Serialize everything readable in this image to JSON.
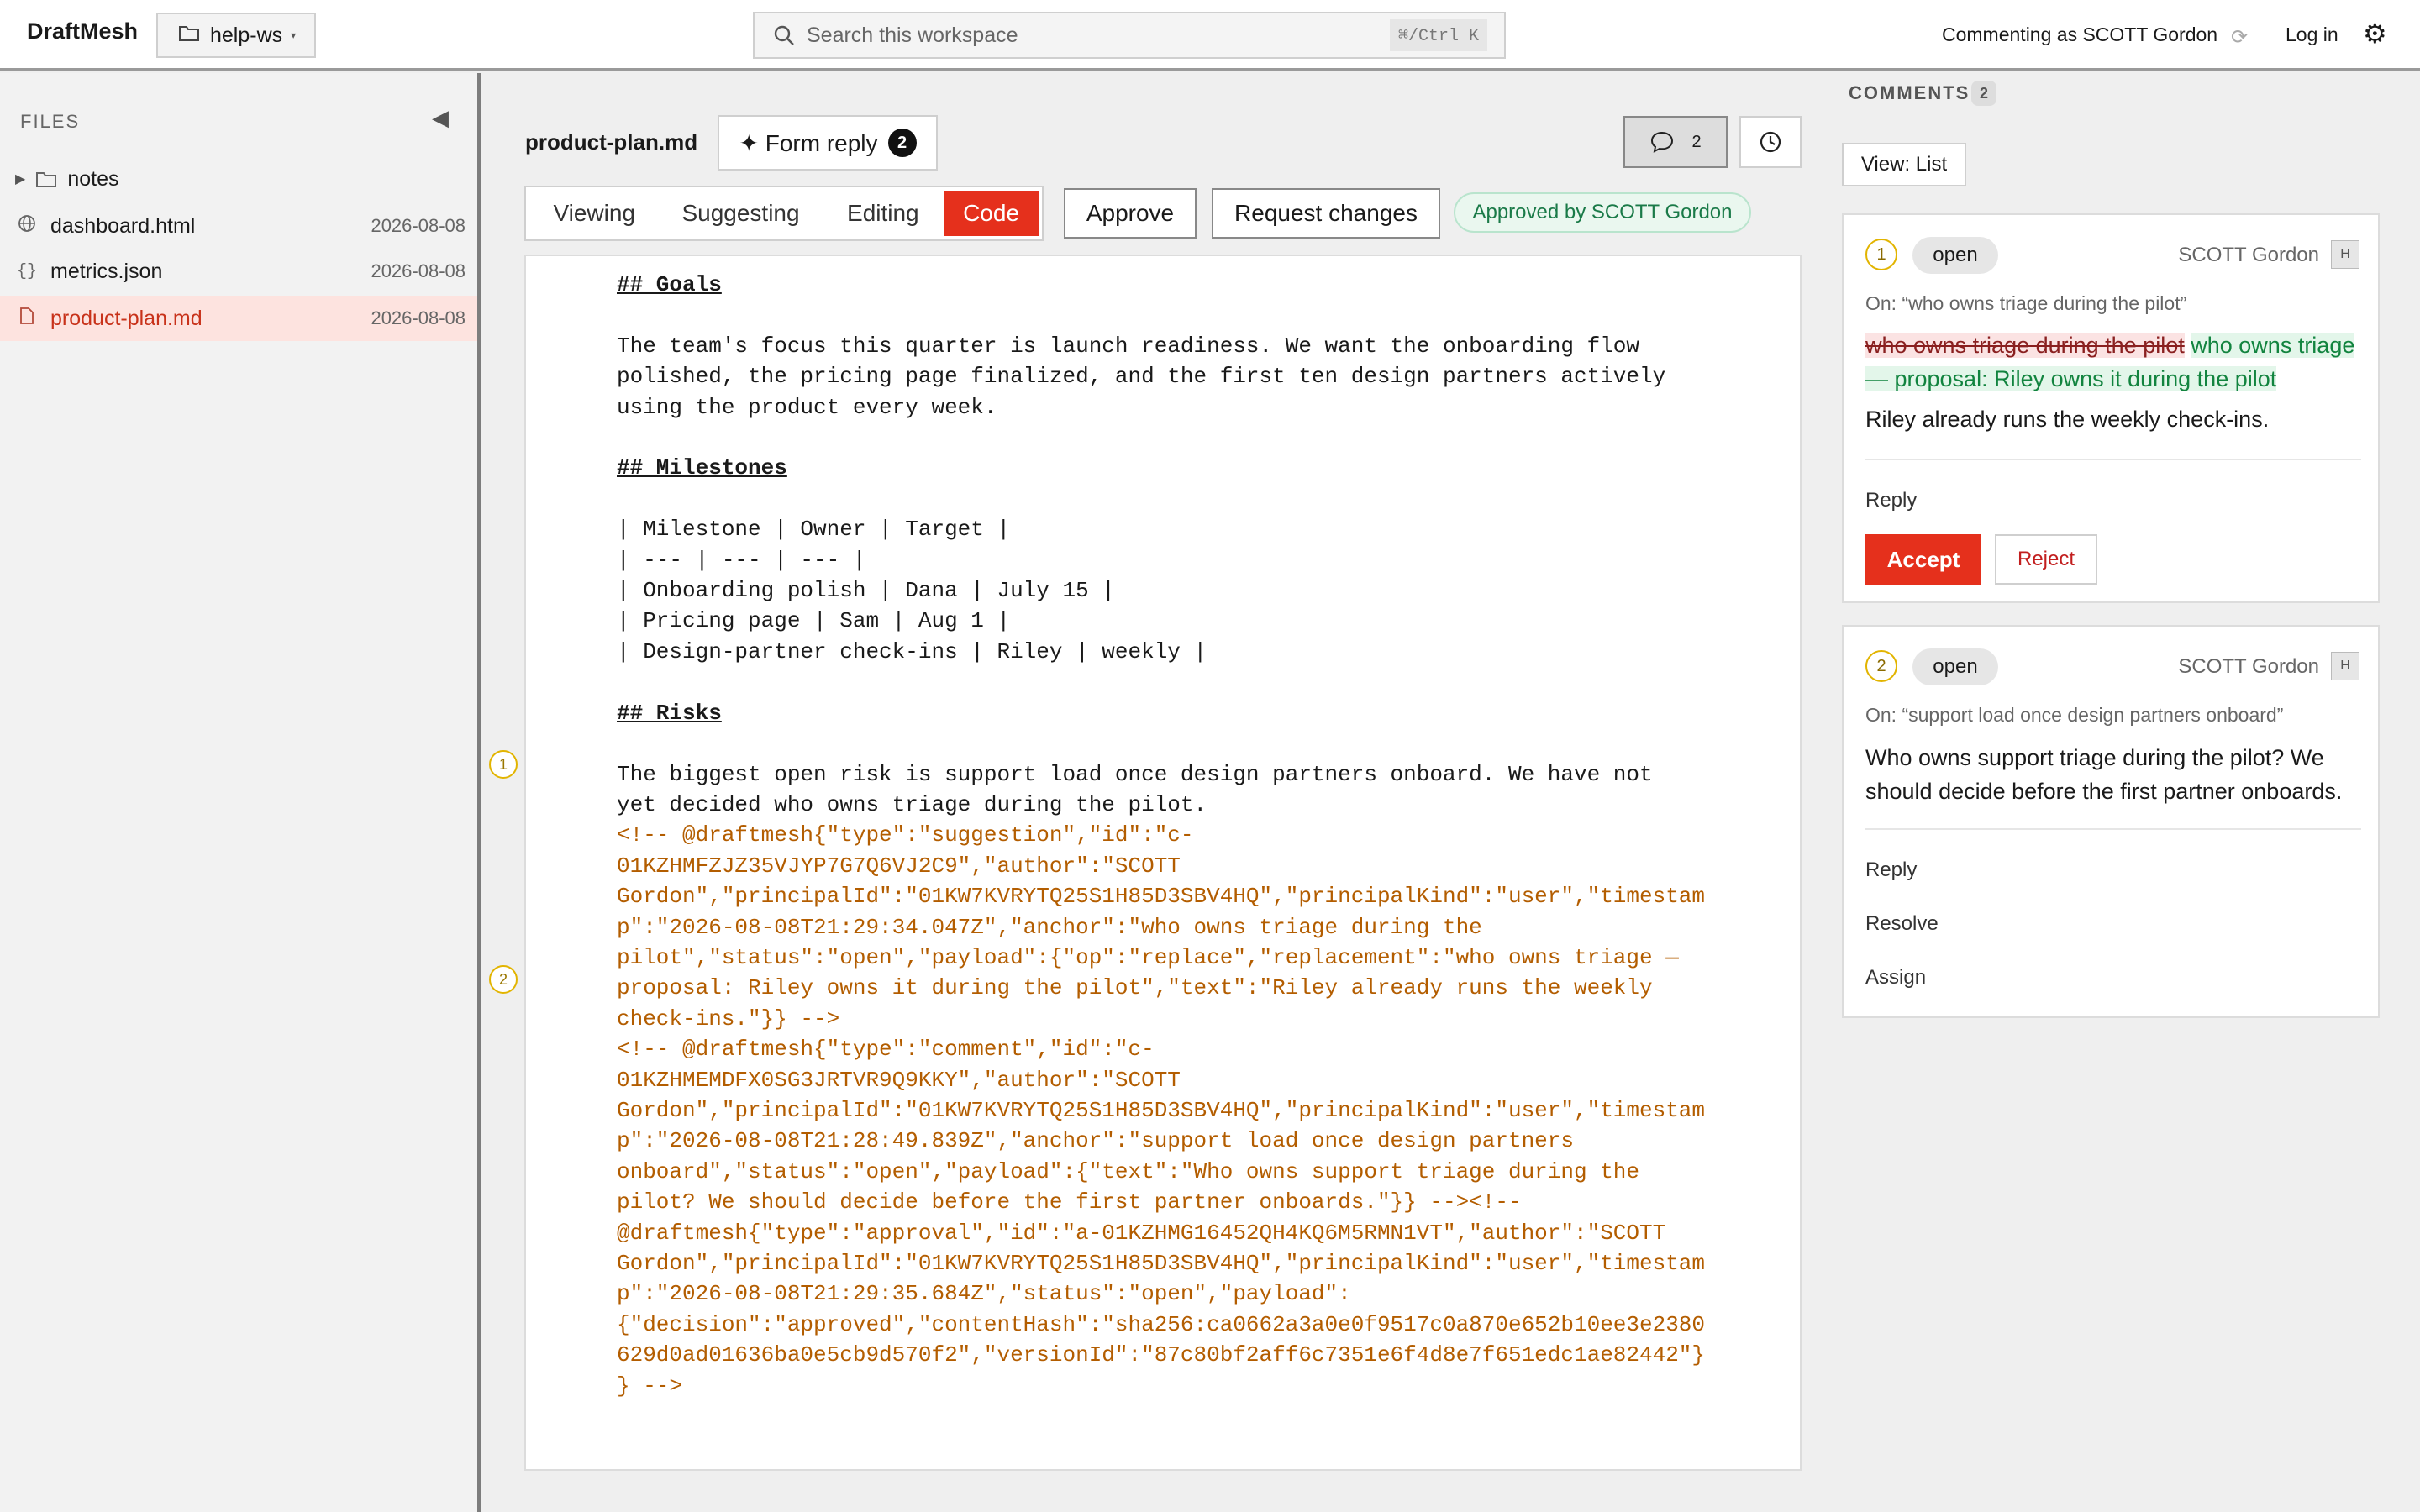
{
  "app": {
    "name": "DraftMesh"
  },
  "workspace": {
    "name": "help-ws",
    "caret": "▾"
  },
  "search": {
    "placeholder": "Search this workspace",
    "shortcut": "⌘/Ctrl K"
  },
  "topbar": {
    "commenting_as": "Commenting as SCOTT Gordon",
    "login": "Log in"
  },
  "sidebar": {
    "title": "FILES",
    "items": [
      {
        "name": "notes",
        "type": "folder",
        "date": ""
      },
      {
        "name": "dashboard.html",
        "type": "html",
        "date": "2026-08-08"
      },
      {
        "name": "metrics.json",
        "type": "json",
        "date": "2026-08-08"
      },
      {
        "name": "product-plan.md",
        "type": "md",
        "date": "2026-08-08",
        "selected": true
      }
    ]
  },
  "editor": {
    "doc_name": "product-plan.md",
    "form_reply": {
      "label": "✦ Form reply",
      "count": "2"
    },
    "comments_count": "2",
    "modes": [
      "Viewing",
      "Suggesting",
      "Editing",
      "Code"
    ],
    "active_mode": "Code",
    "approve": "Approve",
    "request_changes": "Request changes",
    "approved_badge": "Approved by SCOTT Gordon",
    "gutter_marks": [
      "1",
      "2"
    ],
    "lines": [
      {
        "text": "## Goals",
        "style": "h"
      },
      {
        "text": "",
        "style": ""
      },
      {
        "text": "The team's focus this quarter is launch readiness. We want the onboarding flow",
        "style": ""
      },
      {
        "text": "polished, the pricing page finalized, and the first ten design partners actively",
        "style": ""
      },
      {
        "text": "using the product every week.",
        "style": ""
      },
      {
        "text": "",
        "style": ""
      },
      {
        "text": "## Milestones",
        "style": "h"
      },
      {
        "text": "",
        "style": ""
      },
      {
        "text": "| Milestone | Owner | Target |",
        "style": ""
      },
      {
        "text": "| --- | --- | --- |",
        "style": ""
      },
      {
        "text": "| Onboarding polish | Dana | July 15 |",
        "style": ""
      },
      {
        "text": "| Pricing page | Sam | Aug 1 |",
        "style": ""
      },
      {
        "text": "| Design-partner check-ins | Riley | weekly |",
        "style": ""
      },
      {
        "text": "",
        "style": ""
      },
      {
        "text": "## Risks",
        "style": "h"
      },
      {
        "text": "",
        "style": ""
      },
      {
        "text": "The biggest open risk is support load once design partners onboard. We have not",
        "style": ""
      },
      {
        "text": "yet decided who owns triage during the pilot.",
        "style": ""
      },
      {
        "text": "<!-- @draftmesh{\"type\":\"suggestion\",\"id\":\"c-",
        "style": "meta"
      },
      {
        "text": "01KZHMFZJZ35VJYP7G7Q6VJ2C9\",\"author\":\"SCOTT",
        "style": "meta"
      },
      {
        "text": "Gordon\",\"principalId\":\"01KW7KVRYTQ25S1H85D3SBV4HQ\",\"principalKind\":\"user\",\"timestam",
        "style": "meta"
      },
      {
        "text": "p\":\"2026-08-08T21:29:34.047Z\",\"anchor\":\"who owns triage during the",
        "style": "meta"
      },
      {
        "text": "pilot\",\"status\":\"open\",\"payload\":{\"op\":\"replace\",\"replacement\":\"who owns triage —",
        "style": "meta"
      },
      {
        "text": "proposal: Riley owns it during the pilot\",\"text\":\"Riley already runs the weekly",
        "style": "meta"
      },
      {
        "text": "check-ins.\"}} -->",
        "style": "meta"
      },
      {
        "text": "<!-- @draftmesh{\"type\":\"comment\",\"id\":\"c-",
        "style": "meta"
      },
      {
        "text": "01KZHMEMDFX0SG3JRTVR9Q9KKY\",\"author\":\"SCOTT",
        "style": "meta"
      },
      {
        "text": "Gordon\",\"principalId\":\"01KW7KVRYTQ25S1H85D3SBV4HQ\",\"principalKind\":\"user\",\"timestam",
        "style": "meta"
      },
      {
        "text": "p\":\"2026-08-08T21:28:49.839Z\",\"anchor\":\"support load once design partners",
        "style": "meta"
      },
      {
        "text": "onboard\",\"status\":\"open\",\"payload\":{\"text\":\"Who owns support triage during the",
        "style": "meta"
      },
      {
        "text": "pilot? We should decide before the first partner onboards.\"}} --><!--",
        "style": "meta"
      },
      {
        "text": "@draftmesh{\"type\":\"approval\",\"id\":\"a-01KZHMG16452QH4KQ6M5RMN1VT\",\"author\":\"SCOTT",
        "style": "meta"
      },
      {
        "text": "Gordon\",\"principalId\":\"01KW7KVRYTQ25S1H85D3SBV4HQ\",\"principalKind\":\"user\",\"timestam",
        "style": "meta"
      },
      {
        "text": "p\":\"2026-08-08T21:29:35.684Z\",\"status\":\"open\",\"payload\":",
        "style": "meta"
      },
      {
        "text": "{\"decision\":\"approved\",\"contentHash\":\"sha256:ca0662a3a0e0f9517c0a870e652b10ee3e2380",
        "style": "meta"
      },
      {
        "text": "629d0ad01636ba0e5cb9d570f2\",\"versionId\":\"87c80bf2aff6c7351e6f4d8e7f651edc1ae82442\"}",
        "style": "meta"
      },
      {
        "text": "} -->",
        "style": "meta"
      }
    ]
  },
  "comments": {
    "title": "COMMENTS",
    "count": "2",
    "view": "View: List",
    "items": [
      {
        "num": "1",
        "status": "open",
        "author": "SCOTT Gordon",
        "avatar": "H",
        "anchor": "On: “who owns triage during the pilot”",
        "deleted": "who owns triage during the pilot",
        "inserted": "who owns triage — proposal: Riley owns it during the pilot",
        "text": "Riley already runs the weekly check-ins.",
        "reply": "Reply",
        "accept": "Accept",
        "reject": "Reject"
      },
      {
        "num": "2",
        "status": "open",
        "author": "SCOTT Gordon",
        "avatar": "H",
        "anchor": "On: “support load once design partners onboard”",
        "text": "Who owns support triage during the pilot? We should decide before the first partner onboards.",
        "reply": "Reply",
        "resolve": "Resolve",
        "assign": "Assign"
      }
    ]
  },
  "colors": {
    "accent": "#e5301c",
    "approved": "#1a7a48",
    "meta_code": "#b35d00",
    "marker": "#e2b400"
  }
}
